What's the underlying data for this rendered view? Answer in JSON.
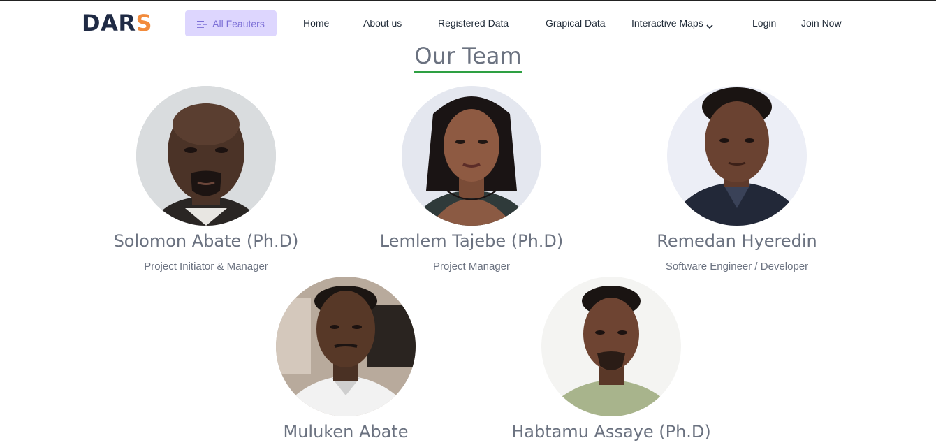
{
  "brand": {
    "name_main": "DAR",
    "name_accent": "S"
  },
  "nav": {
    "features_label": "All Feauters",
    "home": "Home",
    "about": "About us",
    "registered": "Registered Data",
    "graphical": "Grapical Data",
    "maps": "Interactive Maps",
    "login": "Login",
    "join": "Join Now"
  },
  "section": {
    "title": "Our Team"
  },
  "team": [
    {
      "name": "Solomon Abate (Ph.D)",
      "role": "Project Initiator & Manager"
    },
    {
      "name": "Lemlem Tajebe (Ph.D)",
      "role": "Project Manager"
    },
    {
      "name": "Remedan Hyeredin",
      "role": "Software Engineer / Developer"
    },
    {
      "name": "Muluken Abate",
      "role": ""
    },
    {
      "name": "Habtamu Assaye (Ph.D)",
      "role": ""
    }
  ],
  "colors": {
    "accent": "#f28b3c",
    "features_bg": "#ddd6fe",
    "underline": "#2ea043",
    "muted_text": "#6b7280"
  }
}
